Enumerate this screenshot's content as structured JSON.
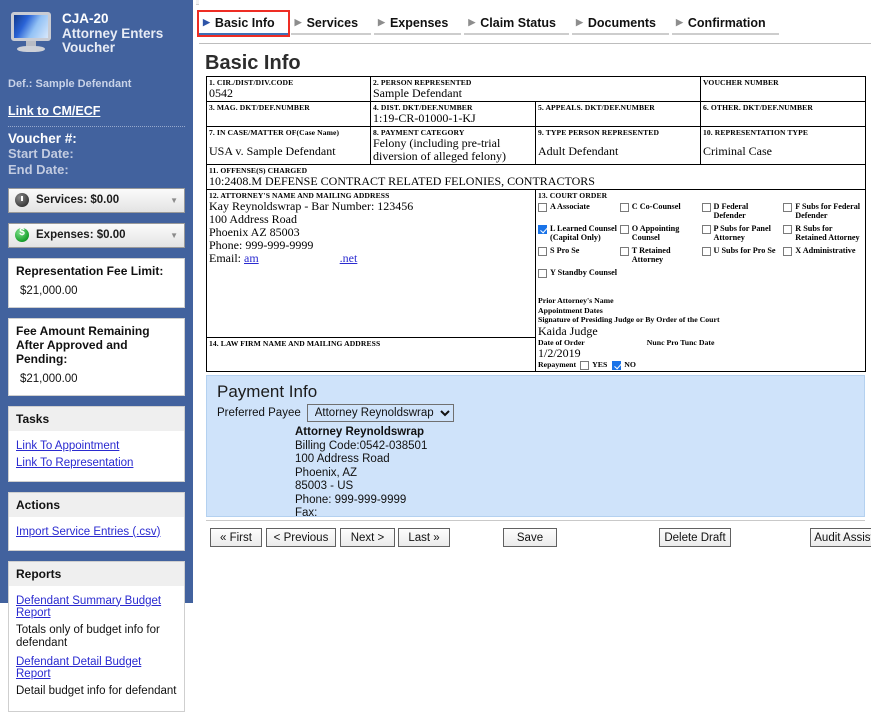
{
  "sidebar": {
    "app_code": "CJA-20",
    "app_role_line1": "Attorney Enters",
    "app_role_line2": "Voucher",
    "defendant": "Def.: Sample Defendant",
    "cmecf_link": "Link to CM/ECF",
    "voucher_label": "Voucher #:",
    "start_date_label": "Start Date:",
    "end_date_label": "End Date:",
    "services_accordion": "Services: $0.00",
    "expenses_accordion": "Expenses: $0.00",
    "fee_limit_label": "Representation Fee Limit:",
    "fee_limit_value": "$21,000.00",
    "fee_remaining_label": "Fee Amount Remaining After Approved and Pending:",
    "fee_remaining_value": "$21,000.00",
    "tasks_header": "Tasks",
    "tasks": [
      "Link To Appointment",
      "Link To Representation"
    ],
    "actions_header": "Actions",
    "actions": [
      "Import Service Entries (.csv)"
    ],
    "reports_header": "Reports",
    "reports": [
      {
        "link": "Defendant Summary Budget Report",
        "desc": "Totals only of budget info for defendant"
      },
      {
        "link": "Defendant Detail Budget Report",
        "desc": "Detail budget info for defendant"
      }
    ]
  },
  "tabs": [
    {
      "label": "Basic Info",
      "active": true
    },
    {
      "label": "Services",
      "active": false
    },
    {
      "label": "Expenses",
      "active": false
    },
    {
      "label": "Claim Status",
      "active": false
    },
    {
      "label": "Documents",
      "active": false
    },
    {
      "label": "Confirmation",
      "active": false
    }
  ],
  "page_title": "Basic Info",
  "form": {
    "f1_label": "1. CIR./DIST/DIV.CODE",
    "f1_value": "0542",
    "f2_label": "2. PERSON REPRESENTED",
    "f2_value": "Sample Defendant",
    "voucher_number_label": "VOUCHER NUMBER",
    "voucher_number_value": "",
    "f3_label": "3. MAG. DKT/DEF.NUMBER",
    "f3_value": "",
    "f4_label": "4. DIST. DKT/DEF.NUMBER",
    "f4_value": "1:19-CR-01000-1-KJ",
    "f5_label": "5. APPEALS. DKT/DEF.NUMBER",
    "f5_value": "",
    "f6_label": "6. OTHER. DKT/DEF.NUMBER",
    "f6_value": "",
    "f7_label": "7. IN CASE/MATTER OF(Case Name)",
    "f7_value": "USA v. Sample Defendant",
    "f8_label": "8. PAYMENT CATEGORY",
    "f8_value": "Felony (including pre-trial diversion of alleged felony)",
    "f9_label": "9. TYPE PERSON REPRESENTED",
    "f9_value": "Adult Defendant",
    "f10_label": "10. REPRESENTATION TYPE",
    "f10_value": "Criminal Case",
    "f11_label": "11. OFFENSE(S) CHARGED",
    "f11_value": "10:2408.M DEFENSE CONTRACT RELATED FELONIES, CONTRACTORS",
    "f12_label": "12. ATTORNEY'S NAME AND MAILING ADDRESS",
    "f12_lines": [
      "Kay Reynoldswrap - Bar Number: 123456",
      "100 Address Road",
      "Phoenix AZ 85003",
      "Phone: 999-999-9999"
    ],
    "f12_email_label": "Email:",
    "f12_email_part1": "am",
    "f12_email_part2": ".net",
    "f14_label": "14. LAW FIRM NAME AND MAILING ADDRESS",
    "f14_value": "",
    "f13_label": "13. COURT ORDER",
    "court_order_options": [
      {
        "code": "A",
        "text": "A Associate",
        "checked": false
      },
      {
        "code": "C",
        "text": "C Co-Counsel",
        "checked": false
      },
      {
        "code": "D",
        "text": "D Federal Defender",
        "checked": false
      },
      {
        "code": "F",
        "text": "F Subs for Federal Defender",
        "checked": false
      },
      {
        "code": "L",
        "text": "L Learned Counsel (Capital Only)",
        "checked": true
      },
      {
        "code": "O",
        "text": "O Appointing Counsel",
        "checked": false
      },
      {
        "code": "P",
        "text": "P Subs for Panel Attorney",
        "checked": false
      },
      {
        "code": "R",
        "text": "R Subs for Retained Attorney",
        "checked": false
      },
      {
        "code": "S",
        "text": "S Pro Se",
        "checked": false
      },
      {
        "code": "T",
        "text": "T Retained Attorney",
        "checked": false
      },
      {
        "code": "U",
        "text": "U Subs for Pro Se",
        "checked": false
      },
      {
        "code": "X",
        "text": "X Administrative",
        "checked": false
      },
      {
        "code": "Y",
        "text": "Y Standby Counsel",
        "checked": false
      }
    ],
    "prior_attorney_label": "Prior Attorney's Name",
    "appointment_dates_label": "Appointment Dates",
    "signature_label": "Signature of Presiding Judge or By Order of the Court",
    "judge_name": "Kaida Judge",
    "date_of_order_label": "Date of Order",
    "nunc_label": "Nunc Pro Tunc Date",
    "date_of_order_value": "1/2/2019",
    "repayment_label": "Repayment",
    "repayment_yes": "YES",
    "repayment_no": "NO",
    "repayment_yes_checked": false,
    "repayment_no_checked": true
  },
  "payment": {
    "heading": "Payment Info",
    "preferred_payee_label": "Preferred Payee",
    "preferred_payee_selected": "Attorney Reynoldswrap",
    "payee_name": "Attorney Reynoldswrap",
    "billing_code": "Billing Code:0542-038501",
    "address": "100 Address Road",
    "city_state": "Phoenix, AZ",
    "zip_country": "85003 - US",
    "phone": "Phone: 999-999-9999",
    "fax": "Fax:"
  },
  "buttons": {
    "first": "« First",
    "previous": "< Previous",
    "next": "Next >",
    "last": "Last »",
    "save": "Save",
    "delete_draft": "Delete Draft",
    "audit_assist": "Audit Assist"
  }
}
